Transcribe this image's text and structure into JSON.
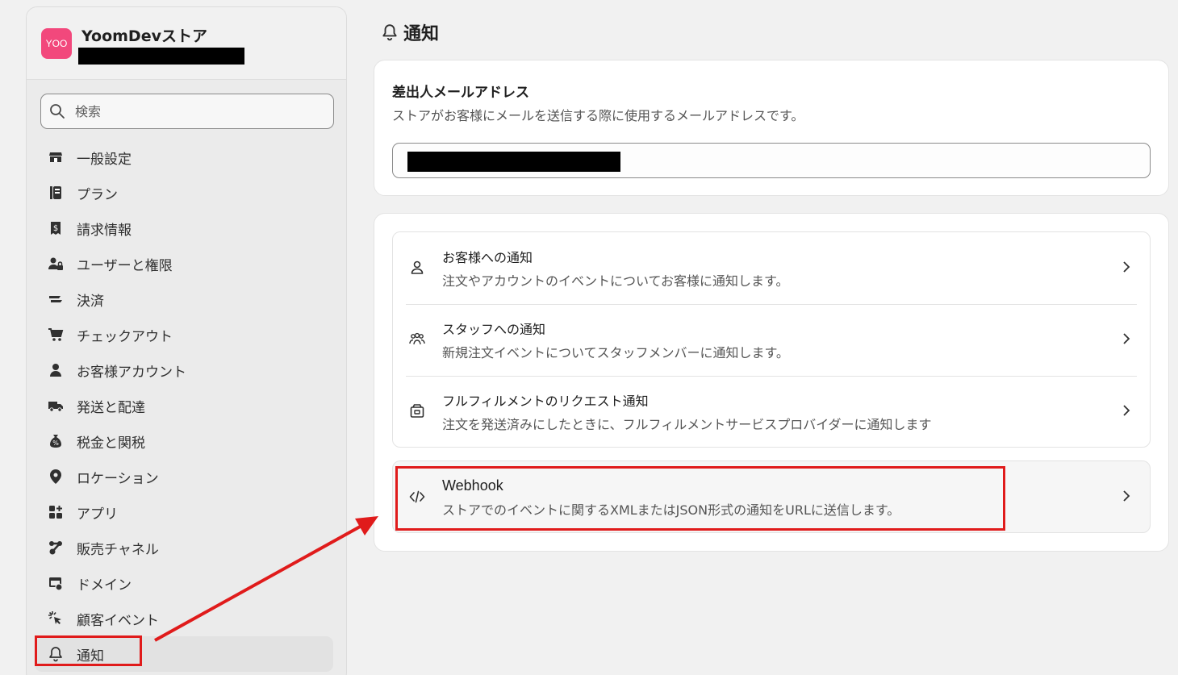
{
  "store": {
    "logo_text": "YOO",
    "name": "YoomDevストア"
  },
  "search": {
    "placeholder": "検索"
  },
  "sidebar": {
    "items": [
      {
        "label": "一般設定",
        "icon": "store-icon"
      },
      {
        "label": "プラン",
        "icon": "plan-icon"
      },
      {
        "label": "請求情報",
        "icon": "receipt-dollar-icon"
      },
      {
        "label": "ユーザーと権限",
        "icon": "person-lock-icon"
      },
      {
        "label": "決済",
        "icon": "payment-icon"
      },
      {
        "label": "チェックアウト",
        "icon": "cart-icon"
      },
      {
        "label": "お客様アカウント",
        "icon": "person-icon"
      },
      {
        "label": "発送と配達",
        "icon": "truck-icon"
      },
      {
        "label": "税金と関税",
        "icon": "tax-icon"
      },
      {
        "label": "ロケーション",
        "icon": "location-pin-icon"
      },
      {
        "label": "アプリ",
        "icon": "apps-icon"
      },
      {
        "label": "販売チャネル",
        "icon": "sales-channel-icon"
      },
      {
        "label": "ドメイン",
        "icon": "domain-icon"
      },
      {
        "label": "顧客イベント",
        "icon": "cursor-click-icon"
      },
      {
        "label": "通知",
        "icon": "bell-icon",
        "active": true
      }
    ]
  },
  "main": {
    "title": "通知",
    "sender": {
      "title": "差出人メールアドレス",
      "description": "ストアがお客様にメールを送信する際に使用するメールアドレスです。"
    },
    "notifications": [
      {
        "title": "お客様への通知",
        "description": "注文やアカウントのイベントについてお客様に通知します。",
        "icon": "person-outline-icon"
      },
      {
        "title": "スタッフへの通知",
        "description": "新規注文イベントについてスタッフメンバーに通知します。",
        "icon": "people-icon"
      },
      {
        "title": "フルフィルメントのリクエスト通知",
        "description": "注文を発送済みにしたときに、フルフィルメントサービスプロバイダーに通知します",
        "icon": "fulfillment-box-icon"
      }
    ],
    "webhook": {
      "title": "Webhook",
      "description": "ストアでのイベントに関するXMLまたはJSON形式の通知をURLに送信します。",
      "icon": "code-icon"
    }
  },
  "colors": {
    "highlight_red": "#e01b1b",
    "store_logo": "#f2487c"
  }
}
